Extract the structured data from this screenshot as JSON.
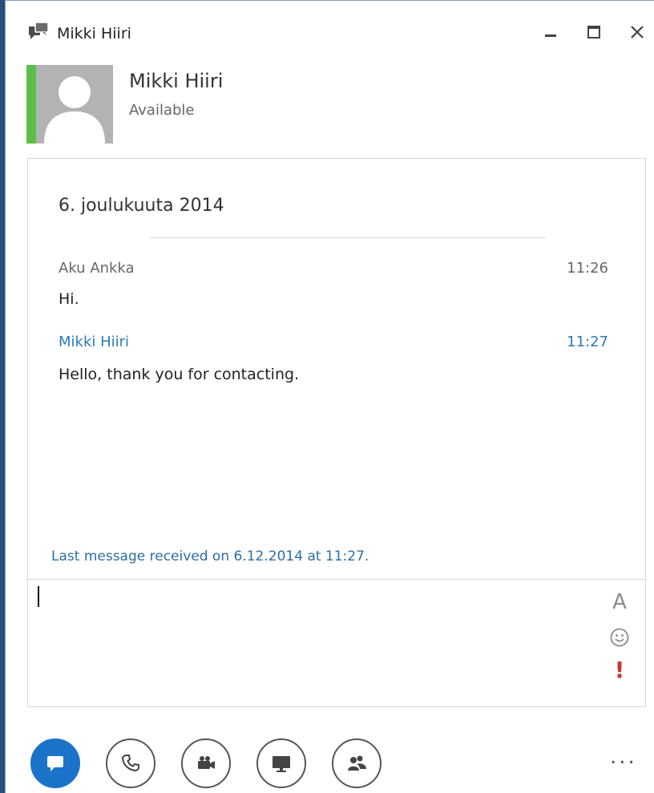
{
  "window": {
    "title": "Mikki Hiiri"
  },
  "contact": {
    "name": "Mikki Hiiri",
    "status": "Available",
    "presence_color": "#5cbd4a"
  },
  "conversation": {
    "date": "6. joulukuuta 2014",
    "messages": [
      {
        "sender": "Aku Ankka",
        "time": "11:26",
        "text": "Hi."
      },
      {
        "sender": "Mikki Hiiri",
        "time": "11:27",
        "text": "Hello, thank you for contacting."
      }
    ],
    "last_message_notice": "Last message received on 6.12.2014 at 11:27."
  },
  "compose": {
    "value": "",
    "font_tool_glyph": "A",
    "important_tool_glyph": "!"
  },
  "toolbar": {
    "buttons": [
      {
        "name": "im-button",
        "icon": "chat-bubble-icon",
        "active": true
      },
      {
        "name": "call-button",
        "icon": "phone-icon",
        "active": false
      },
      {
        "name": "video-button",
        "icon": "video-camera-icon",
        "active": false
      },
      {
        "name": "present-button",
        "icon": "monitor-icon",
        "active": false
      },
      {
        "name": "participants-button",
        "icon": "people-icon",
        "active": false
      }
    ],
    "more_label": "..."
  },
  "colors": {
    "accent": "#1a73c9",
    "self_sender": "#2c7bb6",
    "notice": "#2c6ea3",
    "important": "#c0392b"
  }
}
